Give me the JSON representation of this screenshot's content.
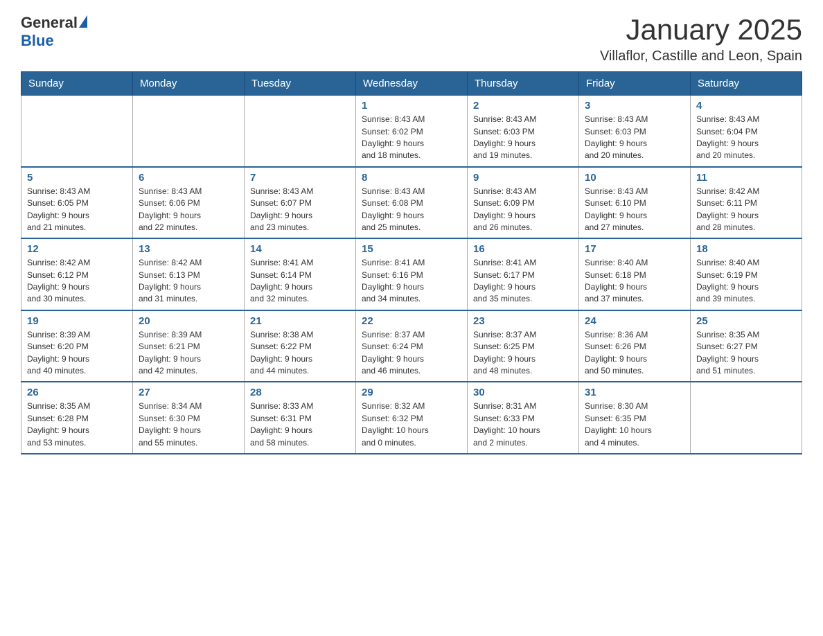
{
  "header": {
    "title": "January 2025",
    "subtitle": "Villaflor, Castille and Leon, Spain"
  },
  "logo": {
    "general": "General",
    "blue": "Blue"
  },
  "days": [
    "Sunday",
    "Monday",
    "Tuesday",
    "Wednesday",
    "Thursday",
    "Friday",
    "Saturday"
  ],
  "weeks": [
    [
      {
        "day": "",
        "info": ""
      },
      {
        "day": "",
        "info": ""
      },
      {
        "day": "",
        "info": ""
      },
      {
        "day": "1",
        "info": "Sunrise: 8:43 AM\nSunset: 6:02 PM\nDaylight: 9 hours\nand 18 minutes."
      },
      {
        "day": "2",
        "info": "Sunrise: 8:43 AM\nSunset: 6:03 PM\nDaylight: 9 hours\nand 19 minutes."
      },
      {
        "day": "3",
        "info": "Sunrise: 8:43 AM\nSunset: 6:03 PM\nDaylight: 9 hours\nand 20 minutes."
      },
      {
        "day": "4",
        "info": "Sunrise: 8:43 AM\nSunset: 6:04 PM\nDaylight: 9 hours\nand 20 minutes."
      }
    ],
    [
      {
        "day": "5",
        "info": "Sunrise: 8:43 AM\nSunset: 6:05 PM\nDaylight: 9 hours\nand 21 minutes."
      },
      {
        "day": "6",
        "info": "Sunrise: 8:43 AM\nSunset: 6:06 PM\nDaylight: 9 hours\nand 22 minutes."
      },
      {
        "day": "7",
        "info": "Sunrise: 8:43 AM\nSunset: 6:07 PM\nDaylight: 9 hours\nand 23 minutes."
      },
      {
        "day": "8",
        "info": "Sunrise: 8:43 AM\nSunset: 6:08 PM\nDaylight: 9 hours\nand 25 minutes."
      },
      {
        "day": "9",
        "info": "Sunrise: 8:43 AM\nSunset: 6:09 PM\nDaylight: 9 hours\nand 26 minutes."
      },
      {
        "day": "10",
        "info": "Sunrise: 8:43 AM\nSunset: 6:10 PM\nDaylight: 9 hours\nand 27 minutes."
      },
      {
        "day": "11",
        "info": "Sunrise: 8:42 AM\nSunset: 6:11 PM\nDaylight: 9 hours\nand 28 minutes."
      }
    ],
    [
      {
        "day": "12",
        "info": "Sunrise: 8:42 AM\nSunset: 6:12 PM\nDaylight: 9 hours\nand 30 minutes."
      },
      {
        "day": "13",
        "info": "Sunrise: 8:42 AM\nSunset: 6:13 PM\nDaylight: 9 hours\nand 31 minutes."
      },
      {
        "day": "14",
        "info": "Sunrise: 8:41 AM\nSunset: 6:14 PM\nDaylight: 9 hours\nand 32 minutes."
      },
      {
        "day": "15",
        "info": "Sunrise: 8:41 AM\nSunset: 6:16 PM\nDaylight: 9 hours\nand 34 minutes."
      },
      {
        "day": "16",
        "info": "Sunrise: 8:41 AM\nSunset: 6:17 PM\nDaylight: 9 hours\nand 35 minutes."
      },
      {
        "day": "17",
        "info": "Sunrise: 8:40 AM\nSunset: 6:18 PM\nDaylight: 9 hours\nand 37 minutes."
      },
      {
        "day": "18",
        "info": "Sunrise: 8:40 AM\nSunset: 6:19 PM\nDaylight: 9 hours\nand 39 minutes."
      }
    ],
    [
      {
        "day": "19",
        "info": "Sunrise: 8:39 AM\nSunset: 6:20 PM\nDaylight: 9 hours\nand 40 minutes."
      },
      {
        "day": "20",
        "info": "Sunrise: 8:39 AM\nSunset: 6:21 PM\nDaylight: 9 hours\nand 42 minutes."
      },
      {
        "day": "21",
        "info": "Sunrise: 8:38 AM\nSunset: 6:22 PM\nDaylight: 9 hours\nand 44 minutes."
      },
      {
        "day": "22",
        "info": "Sunrise: 8:37 AM\nSunset: 6:24 PM\nDaylight: 9 hours\nand 46 minutes."
      },
      {
        "day": "23",
        "info": "Sunrise: 8:37 AM\nSunset: 6:25 PM\nDaylight: 9 hours\nand 48 minutes."
      },
      {
        "day": "24",
        "info": "Sunrise: 8:36 AM\nSunset: 6:26 PM\nDaylight: 9 hours\nand 50 minutes."
      },
      {
        "day": "25",
        "info": "Sunrise: 8:35 AM\nSunset: 6:27 PM\nDaylight: 9 hours\nand 51 minutes."
      }
    ],
    [
      {
        "day": "26",
        "info": "Sunrise: 8:35 AM\nSunset: 6:28 PM\nDaylight: 9 hours\nand 53 minutes."
      },
      {
        "day": "27",
        "info": "Sunrise: 8:34 AM\nSunset: 6:30 PM\nDaylight: 9 hours\nand 55 minutes."
      },
      {
        "day": "28",
        "info": "Sunrise: 8:33 AM\nSunset: 6:31 PM\nDaylight: 9 hours\nand 58 minutes."
      },
      {
        "day": "29",
        "info": "Sunrise: 8:32 AM\nSunset: 6:32 PM\nDaylight: 10 hours\nand 0 minutes."
      },
      {
        "day": "30",
        "info": "Sunrise: 8:31 AM\nSunset: 6:33 PM\nDaylight: 10 hours\nand 2 minutes."
      },
      {
        "day": "31",
        "info": "Sunrise: 8:30 AM\nSunset: 6:35 PM\nDaylight: 10 hours\nand 4 minutes."
      },
      {
        "day": "",
        "info": ""
      }
    ]
  ]
}
